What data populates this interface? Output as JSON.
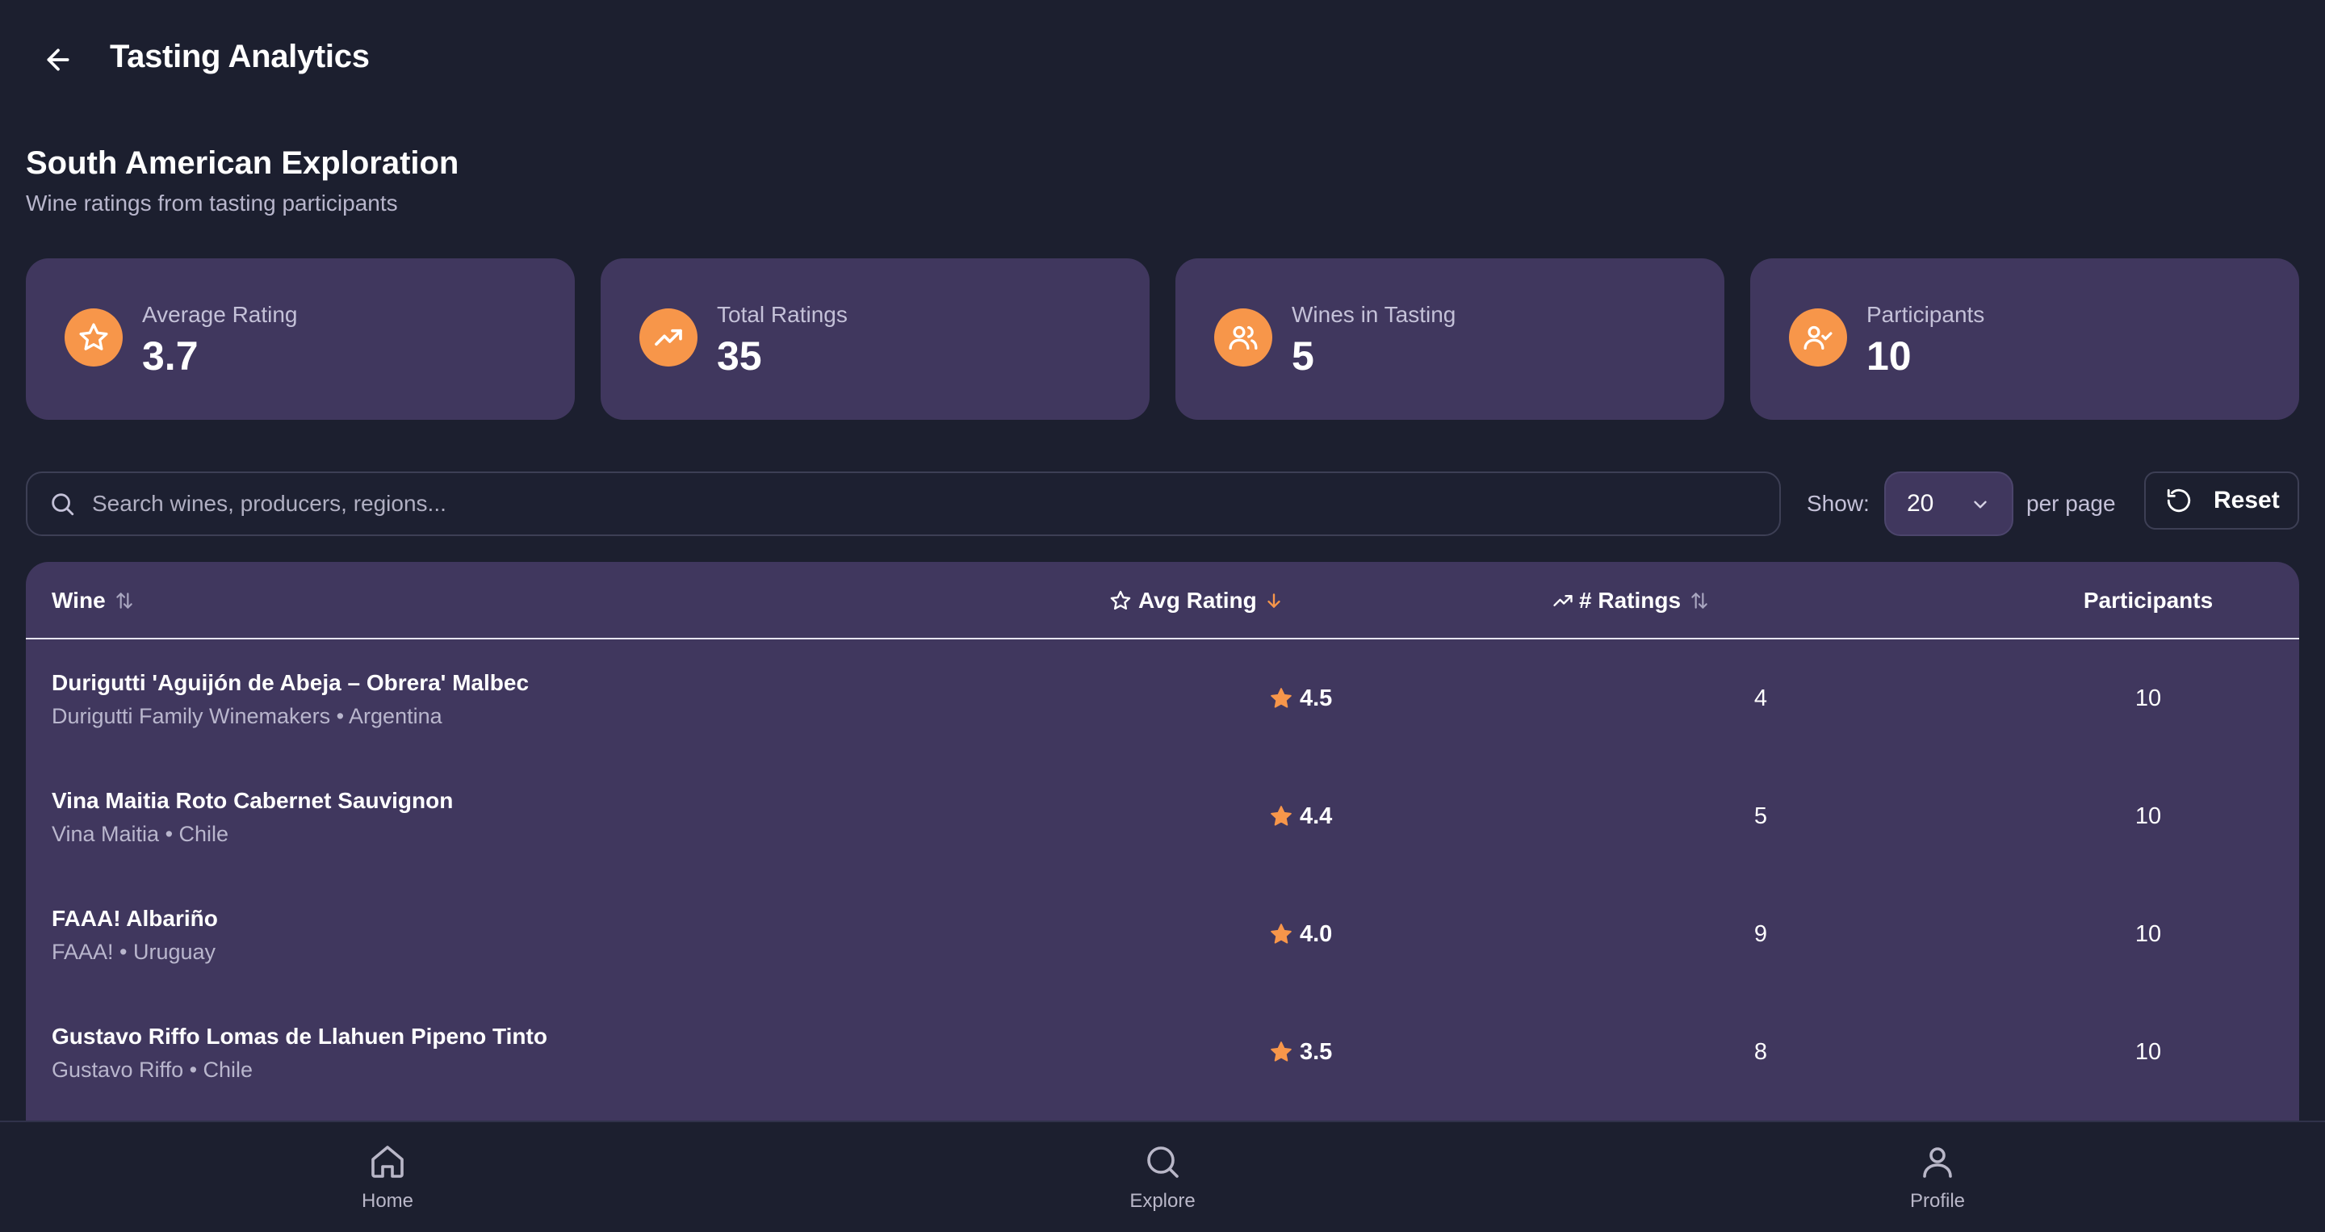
{
  "header": {
    "title": "Tasting Analytics"
  },
  "tasting": {
    "title": "South American Exploration",
    "subtitle": "Wine ratings from tasting participants"
  },
  "stats": [
    {
      "label": "Average Rating",
      "value": "3.7",
      "icon": "star-icon"
    },
    {
      "label": "Total Ratings",
      "value": "35",
      "icon": "trending-up-icon"
    },
    {
      "label": "Wines in Tasting",
      "value": "5",
      "icon": "users-icon"
    },
    {
      "label": "Participants",
      "value": "10",
      "icon": "user-check-icon"
    }
  ],
  "toolbar": {
    "search_placeholder": "Search wines, producers, regions...",
    "search_value": "",
    "show_label": "Show:",
    "per_page_value": "20",
    "per_page_label": "per page",
    "reset_label": "Reset"
  },
  "table": {
    "columns": {
      "wine": "Wine",
      "avg": "Avg Rating",
      "num": "# Ratings",
      "participants": "Participants"
    },
    "rows": [
      {
        "name": "Durigutti 'Aguijón de Abeja – Obrera' Malbec",
        "meta": "Durigutti Family Winemakers • Argentina",
        "avg": "4.5",
        "num": "4",
        "participants": "10"
      },
      {
        "name": "Vina Maitia Roto Cabernet Sauvignon",
        "meta": "Vina Maitia • Chile",
        "avg": "4.4",
        "num": "5",
        "participants": "10"
      },
      {
        "name": "FAAA! Albariño",
        "meta": "FAAA! • Uruguay",
        "avg": "4.0",
        "num": "9",
        "participants": "10"
      },
      {
        "name": "Gustavo Riffo Lomas de Llahuen Pipeno Tinto",
        "meta": "Gustavo Riffo • Chile",
        "avg": "3.5",
        "num": "8",
        "participants": "10"
      }
    ]
  },
  "nav": {
    "home": "Home",
    "explore": "Explore",
    "profile": "Profile"
  },
  "colors": {
    "background": "#1c1f2f",
    "card": "#40375e",
    "accent": "#f7964a"
  }
}
